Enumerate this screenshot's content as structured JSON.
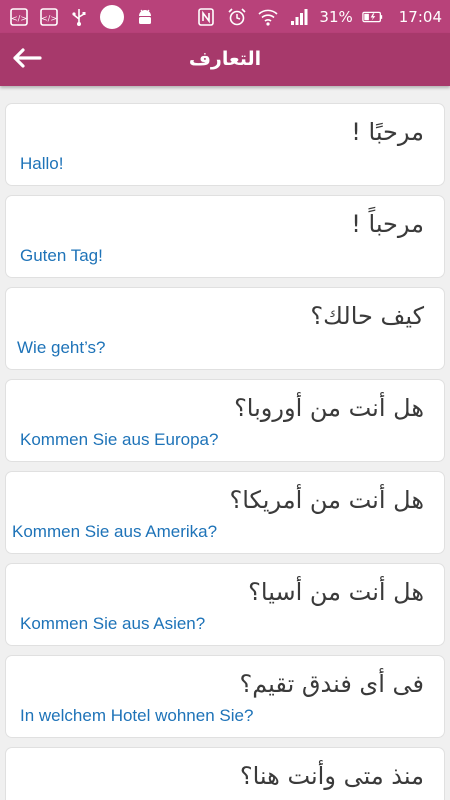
{
  "status_bar": {
    "battery": "31%",
    "time": "17:04",
    "icons": [
      "code-icon",
      "code-icon",
      "usb-icon",
      "circle-icon",
      "android-icon",
      "nfc-icon",
      "alarm-icon",
      "wifi-icon",
      "signal-icon",
      "battery-charging-icon"
    ]
  },
  "app_bar": {
    "title": "التعارف",
    "back_icon": "arrow-left-icon"
  },
  "phrases": [
    {
      "ar": "مرحبًا !",
      "de": "Hallo!"
    },
    {
      "ar": "مرحباً !",
      "de": "Guten Tag!"
    },
    {
      "ar": "كيف حالك؟",
      "de": "Wie geht’s?"
    },
    {
      "ar": "هل أنت من أوروبا؟",
      "de": "Kommen Sie aus Europa?"
    },
    {
      "ar": "هل أنت من أمريكا؟",
      "de": "Kommen Sie aus Amerika?"
    },
    {
      "ar": "هل أنت من أسيا؟",
      "de": "Kommen Sie aus Asien?"
    },
    {
      "ar": "فى أى فندق تقيم؟",
      "de": "In welchem Hotel wohnen Sie?"
    },
    {
      "ar": "منذ متى وأنت هنا؟",
      "de": ""
    }
  ],
  "colors": {
    "status_bar": "#b8427a",
    "app_bar": "#a7396b",
    "german_text": "#1e73b8",
    "arabic_text": "#3a3a3a"
  }
}
